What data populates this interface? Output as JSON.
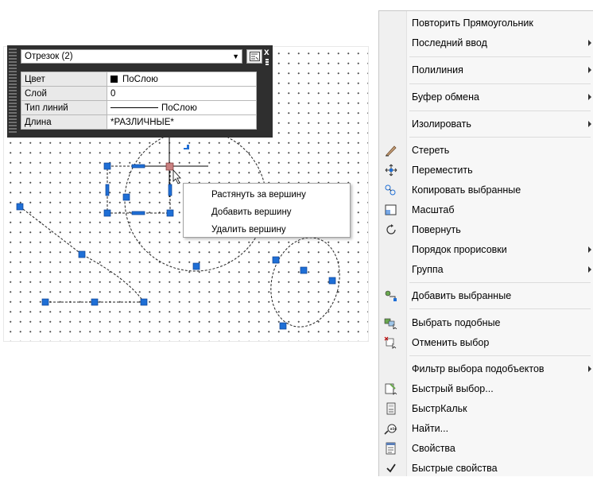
{
  "quick_properties": {
    "object_select": "Отрезок (2)",
    "close_label": "x",
    "rows": [
      {
        "key": "Цвет",
        "value": "ПоСлою"
      },
      {
        "key": "Слой",
        "value": "0"
      },
      {
        "key": "Тип линий",
        "value": "ПоСлою"
      },
      {
        "key": "Длина",
        "value": "*РАЗЛИЧНЫЕ*"
      }
    ]
  },
  "grip_menu": {
    "items": [
      "Растянуть за вершину",
      "Добавить вершину",
      "Удалить вершину"
    ]
  },
  "context_menu": {
    "items": [
      {
        "label": "Повторить Прямоугольник",
        "icon": "",
        "submenu": false
      },
      {
        "label": "Последний ввод",
        "icon": "",
        "submenu": true
      },
      {
        "label": "Полилиния",
        "icon": "",
        "submenu": true
      },
      {
        "label": "Буфер обмена",
        "icon": "",
        "submenu": true
      },
      {
        "label": "Изолировать",
        "icon": "",
        "submenu": true
      },
      {
        "label": "Стереть",
        "icon": "eraser-icon",
        "submenu": false
      },
      {
        "label": "Переместить",
        "icon": "move-icon",
        "submenu": false
      },
      {
        "label": "Копировать выбранные",
        "icon": "copy-icon",
        "submenu": false
      },
      {
        "label": "Масштаб",
        "icon": "scale-icon",
        "submenu": false
      },
      {
        "label": "Повернуть",
        "icon": "rotate-icon",
        "submenu": false
      },
      {
        "label": "Порядок прорисовки",
        "icon": "",
        "submenu": true
      },
      {
        "label": "Группа",
        "icon": "",
        "submenu": true
      },
      {
        "label": "Добавить выбранные",
        "icon": "add-selected-icon",
        "submenu": false
      },
      {
        "label": "Выбрать подобные",
        "icon": "select-similar-icon",
        "submenu": false
      },
      {
        "label": "Отменить выбор",
        "icon": "deselect-icon",
        "submenu": false
      },
      {
        "label": "Фильтр выбора подобъектов",
        "icon": "",
        "submenu": true
      },
      {
        "label": "Быстрый выбор...",
        "icon": "quick-select-icon",
        "submenu": false
      },
      {
        "label": "БыстрКальк",
        "icon": "calculator-icon",
        "submenu": false
      },
      {
        "label": "Найти...",
        "icon": "find-icon",
        "submenu": false
      },
      {
        "label": "Свойства",
        "icon": "properties-icon",
        "submenu": false
      },
      {
        "label": "Быстрые свойства",
        "icon": "checkmark-icon",
        "submenu": false
      }
    ]
  },
  "colors": {
    "grip": "#1f6fd6",
    "grip_hot": "#c07070",
    "panel": "#2f2f2f"
  }
}
